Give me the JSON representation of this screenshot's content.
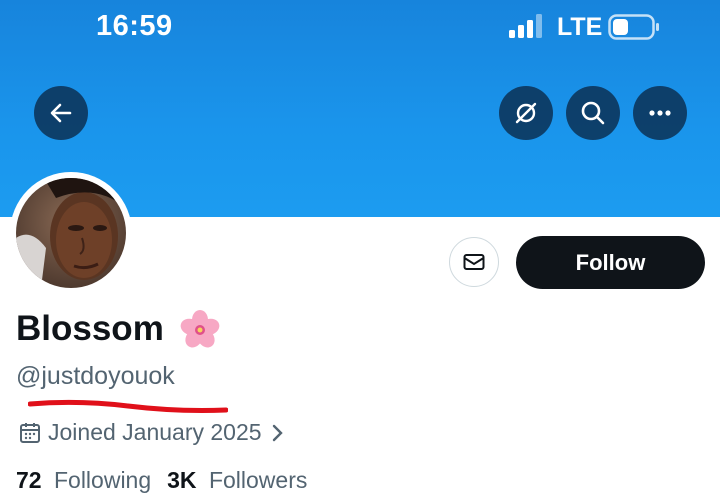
{
  "status_bar": {
    "time": "16:59",
    "network": "LTE"
  },
  "profile": {
    "display_name": "Blossom",
    "name_emoji": "cherry-blossom-icon",
    "handle": "@justdoyouok",
    "joined": "Joined January 2025",
    "following_count": "72",
    "following_label": "Following",
    "followers_count": "3K",
    "followers_label": "Followers"
  },
  "actions": {
    "follow_label": "Follow"
  },
  "icons": [
    "back-arrow-icon",
    "mute-icon",
    "search-icon",
    "more-icon",
    "mail-icon",
    "calendar-icon",
    "chevron-right-icon"
  ],
  "colors": {
    "banner": "#1d9bf0",
    "follow_button": "#0f1419",
    "handle_underline": "#e0101a"
  }
}
